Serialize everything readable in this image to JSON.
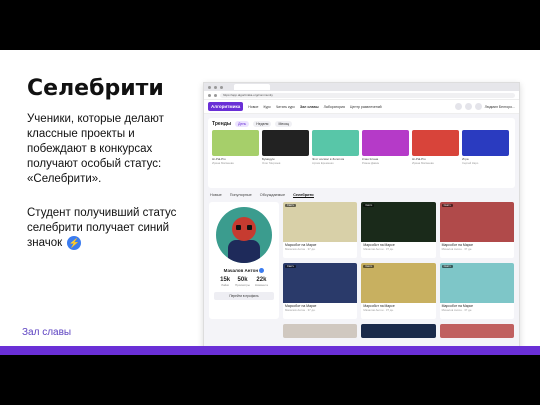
{
  "slide": {
    "title": "Селебрити",
    "desc": "Ученики, которые делают классные проекты и побеждают в конкурсах получают особый статус: «Селебрити».",
    "desc2": "Студент получивший статус селебрити получает синий значок",
    "bolt_icon": "⚡",
    "hall": "Зал славы",
    "accent": "#6a2fd6"
  },
  "browser": {
    "url": "https://app.algoritmika.org/community",
    "logo": "Алгоритмика",
    "nav": [
      "Новое",
      "Курс",
      "Читать курс",
      "Зал славы",
      "Лаборатория",
      "Центр развлечений"
    ],
    "active_nav": "Зал славы",
    "user": "Людмил Белгоро...",
    "trends": {
      "title": "Тренды",
      "chips": [
        "День",
        "Неделя",
        "Месяц"
      ],
      "active_chip": "День",
      "cards": [
        {
          "title": "Hi-Pal-Pro",
          "meta": "Ирина Матвеева",
          "color": "#a6cf6a"
        },
        {
          "title": "Бумидум",
          "meta": "Олег Мерзоев",
          "color": "#222"
        },
        {
          "title": "Этот космос в Золотом",
          "meta": "Артем Еременко",
          "color": "#58c6a8"
        },
        {
          "title": "Клан Клана",
          "meta": "Роман Давин",
          "color": "#b53ac8"
        },
        {
          "title": "Hi-Pal-Pro",
          "meta": "Ирина Матвеева",
          "color": "#d8443a"
        },
        {
          "title": "Игра",
          "meta": "Сергей Каро",
          "color": "#2a3bc0"
        }
      ]
    },
    "tabs": [
      "Новые",
      "Популярные",
      "Обсуждаемые",
      "Селебрити"
    ],
    "active_tab": "Селебрити",
    "profile": {
      "name": "Мачалов Антон",
      "stats": [
        {
          "n": "15k",
          "l": "Лайки"
        },
        {
          "n": "50k",
          "l": "Просмотры"
        },
        {
          "n": "22k",
          "l": "Коммента"
        }
      ],
      "button": "Перейти в профиль"
    },
    "grid": [
      {
        "badge": "Скетч",
        "title": "Марсобот на Марсе",
        "meta": "Мачалов Антон · 37 дн.",
        "color": "#d8d0a8"
      },
      {
        "badge": "Скетч",
        "title": "Марсобот на Марсе",
        "meta": "Мачалов Антон · 37 дн.",
        "color": "#1a2a1a"
      },
      {
        "badge": "Скетч",
        "title": "Марсобот на Марсе",
        "meta": "Мачалов Антон · 37 дн.",
        "color": "#b04a4a"
      },
      {
        "badge": "Скетч",
        "title": "Марсобот на Марсе",
        "meta": "Мачалов Антон · 37 дн.",
        "color": "#2a3a6a"
      },
      {
        "badge": "Скетч",
        "title": "Марсобот на Марсе",
        "meta": "Мачалов Антон · 37 дн.",
        "color": "#c8b060"
      },
      {
        "badge": "Скетч",
        "title": "Марсобот на Марсе",
        "meta": "Мачалов Антон · 37 дн.",
        "color": "#7ec6c8"
      }
    ],
    "row2_colors": [
      "#d0c8c0",
      "#1a2a4a",
      "#c06060"
    ]
  }
}
